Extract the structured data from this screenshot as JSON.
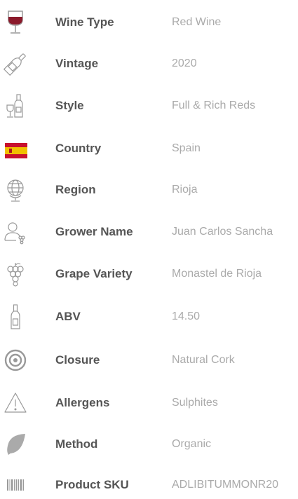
{
  "specs": [
    {
      "icon": "wine-glass-icon",
      "label": "Wine Type",
      "value": "Red Wine"
    },
    {
      "icon": "bottle-icon",
      "label": "Vintage",
      "value": "2020"
    },
    {
      "icon": "bottle-and-glass-icon",
      "label": "Style",
      "value": "Full & Rich Reds"
    },
    {
      "icon": "spain-flag-icon",
      "label": "Country",
      "value": "Spain"
    },
    {
      "icon": "globe-icon",
      "label": "Region",
      "value": "Rioja"
    },
    {
      "icon": "grower-icon",
      "label": "Grower Name",
      "value": "Juan Carlos Sancha"
    },
    {
      "icon": "grapes-icon",
      "label": "Grape Variety",
      "value": "Monastel de Rioja"
    },
    {
      "icon": "abv-bottle-icon",
      "label": "ABV",
      "value": "14.50"
    },
    {
      "icon": "cork-target-icon",
      "label": "Closure",
      "value": "Natural Cork"
    },
    {
      "icon": "warning-icon",
      "label": "Allergens",
      "value": "Sulphites"
    },
    {
      "icon": "leaf-icon",
      "label": "Method",
      "value": "Organic"
    },
    {
      "icon": "barcode-icon",
      "label": "Product SKU",
      "value": "ADLIBITUMMONR20"
    }
  ],
  "colors": {
    "label": "#555555",
    "value": "#aaaaaa",
    "icon": "#999999",
    "wine": "#8b1a2b",
    "flag_red": "#c8102e",
    "flag_yellow": "#f1bf00"
  }
}
